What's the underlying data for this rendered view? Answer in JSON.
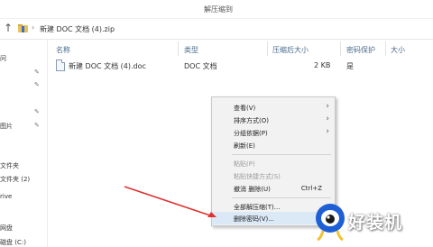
{
  "toolbar": {
    "tool_label": "解压缩到"
  },
  "address": {
    "separator": "›",
    "path": "新建 DOC 文档 (4).zip"
  },
  "nav": {
    "items": [
      {
        "label": "问"
      },
      {
        "label": "图片"
      },
      {
        "label": "文件夹"
      },
      {
        "label": "文件夹 (2)"
      },
      {
        "label": "rive"
      },
      {
        "label": "网盘"
      },
      {
        "label": "磁盘 (C:)"
      }
    ]
  },
  "columns": {
    "name": "名称",
    "type": "类型",
    "compressed_size": "压缩后大小",
    "password": "密码保护",
    "size": "大小"
  },
  "file": {
    "name": "新建 DOC 文档 (4).doc",
    "type": "DOC 文档",
    "compressed_size": "2 KB",
    "password": "是"
  },
  "context_menu": {
    "items": [
      {
        "label": "查看(V)",
        "submenu": true
      },
      {
        "label": "排序方式(O)",
        "submenu": true
      },
      {
        "label": "分组依据(P)",
        "submenu": true
      },
      {
        "label": "刷新(E)"
      },
      {
        "label": "粘贴(P)",
        "disabled": true
      },
      {
        "label": "粘贴快捷方式(S)",
        "disabled": true
      },
      {
        "label": "撤消 删除(U)",
        "shortcut": "Ctrl+Z"
      },
      {
        "label": "全部解压缩(T)..."
      },
      {
        "label": "删除密码(V)...",
        "highlighted": true
      }
    ]
  },
  "watermark": {
    "text": "好装机",
    "icon": "eye-mascot-logo"
  },
  "colors": {
    "accent_arrow": "#e03030",
    "menu_bg": "#f2f2f2",
    "header_text": "#4a6a8a"
  }
}
